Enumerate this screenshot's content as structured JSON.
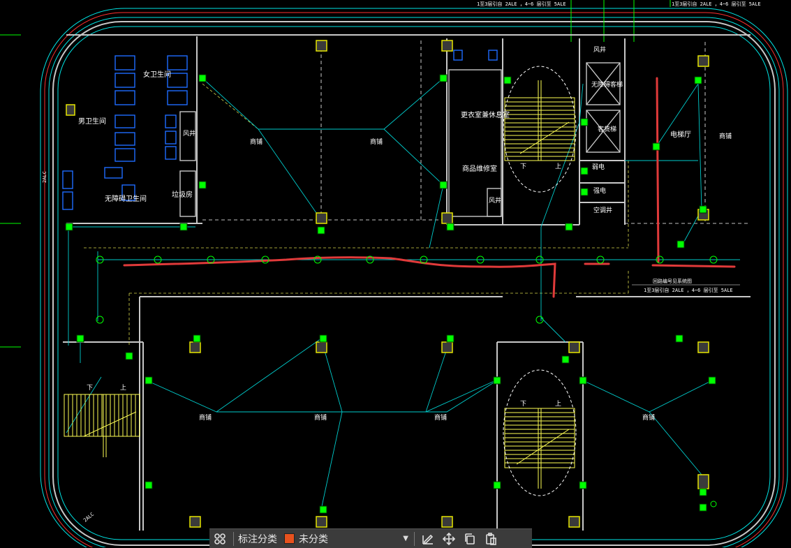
{
  "drawing": {
    "notes": [
      "1至3层引自 2ALE ，4~6 层引至 5ALE",
      "1至3层引自 2ALE ，4~6 层引至 5ALE",
      "回路编号见系统图",
      "1至3层引自 2ALE ，4~6 层引至 5ALE"
    ],
    "side_labels": [
      "2ALC",
      "2ALC"
    ],
    "rooms": {
      "women_wc": "女卫生间",
      "men_wc": "男卫生间",
      "accessible_wc": "无障碍卫生间",
      "garbage": "垃圾房",
      "fan_shaft_left": "风井",
      "shop_top_1": "商铺",
      "shop_top_2": "商铺",
      "changing_room": "更衣室兼休息室",
      "repair_room": "商品维修室",
      "fan_shaft_mid": "风井",
      "fan_shaft_right": "风井",
      "accessible_elevator": "无障碍客梯",
      "passenger_elevator": "客货梯",
      "weak_current": "弱电",
      "strong_current": "强电",
      "ac_well": "空调井",
      "elevator_hall": "电梯厅",
      "shop_right": "商铺",
      "shop_bottom_1": "商铺",
      "shop_bottom_2": "商铺",
      "shop_bottom_3": "商铺",
      "shop_bottom_4": "商铺",
      "stair_down_1": "下",
      "stair_up_1": "上",
      "stair_down_2": "下",
      "stair_up_2": "上",
      "stair_down_3": "下",
      "stair_up_3": "上"
    },
    "colors": {
      "wall": "#c8c8c8",
      "boundary": "#00e5e5",
      "red_line": "#ff3030",
      "dashed_partition": "#ffffff",
      "fixture": "#1e6bff",
      "stair": "#ffff55",
      "device": "#00ff00",
      "annotation_red": "#e03a3a"
    }
  },
  "toolbar": {
    "label": "标注分类",
    "category": "未分类",
    "category_color": "#e8521e",
    "icons": [
      "grid-icon",
      "edit-icon",
      "move-icon",
      "copy-icon",
      "paste-icon"
    ]
  }
}
